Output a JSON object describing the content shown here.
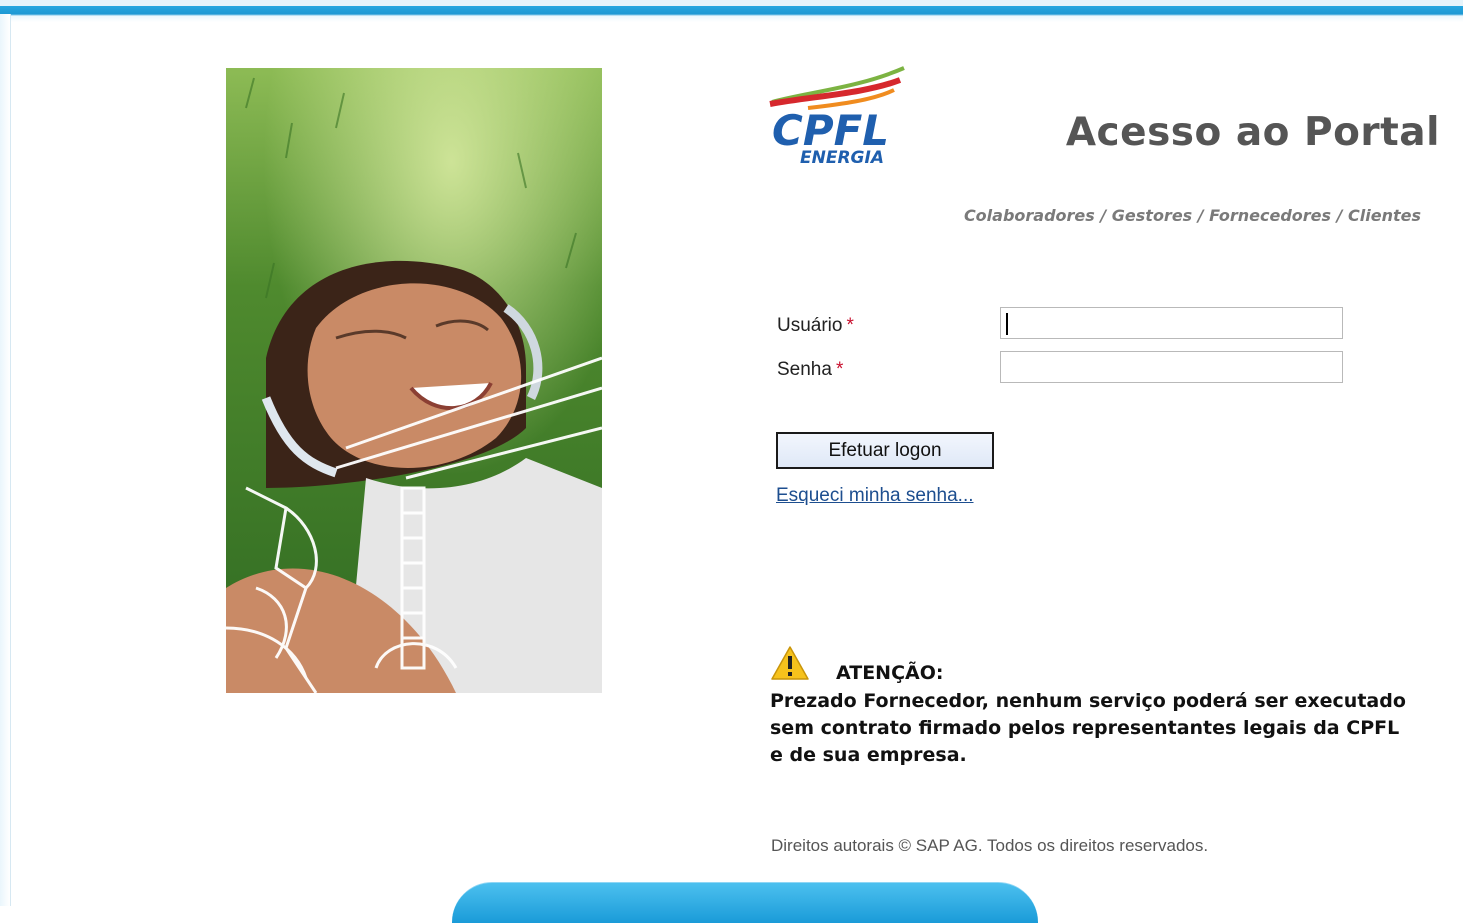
{
  "header": {
    "logo_text": "CPFL",
    "logo_subtext": "ENERGIA",
    "title": "Acesso ao Portal",
    "subtitle": "Colaboradores / Gestores / Fornecedores / Clientes"
  },
  "form": {
    "user_label": "Usuário",
    "user_value": "",
    "password_label": "Senha",
    "password_value": "",
    "required_mark": "*",
    "logon_button": "Efetuar logon",
    "forgot_link": "Esqueci minha senha..."
  },
  "notice": {
    "title": "ATENÇÃO:",
    "text": "Prezado Fornecedor, nenhum serviço poderá ser executado sem contrato firmado pelos representantes legais da CPFL e de sua empresa."
  },
  "footer": {
    "copyright": "Direitos autorais © SAP AG. Todos os direitos reservados."
  },
  "colors": {
    "accent_blue": "#1d98d3",
    "brand_blue": "#1f5fae",
    "brand_red": "#d6282d",
    "brand_orange": "#f08c1f",
    "brand_green": "#7cb342",
    "link": "#1d4e8f",
    "required": "#c8102e"
  },
  "icons": {
    "warning": "warning-triangle-icon"
  }
}
